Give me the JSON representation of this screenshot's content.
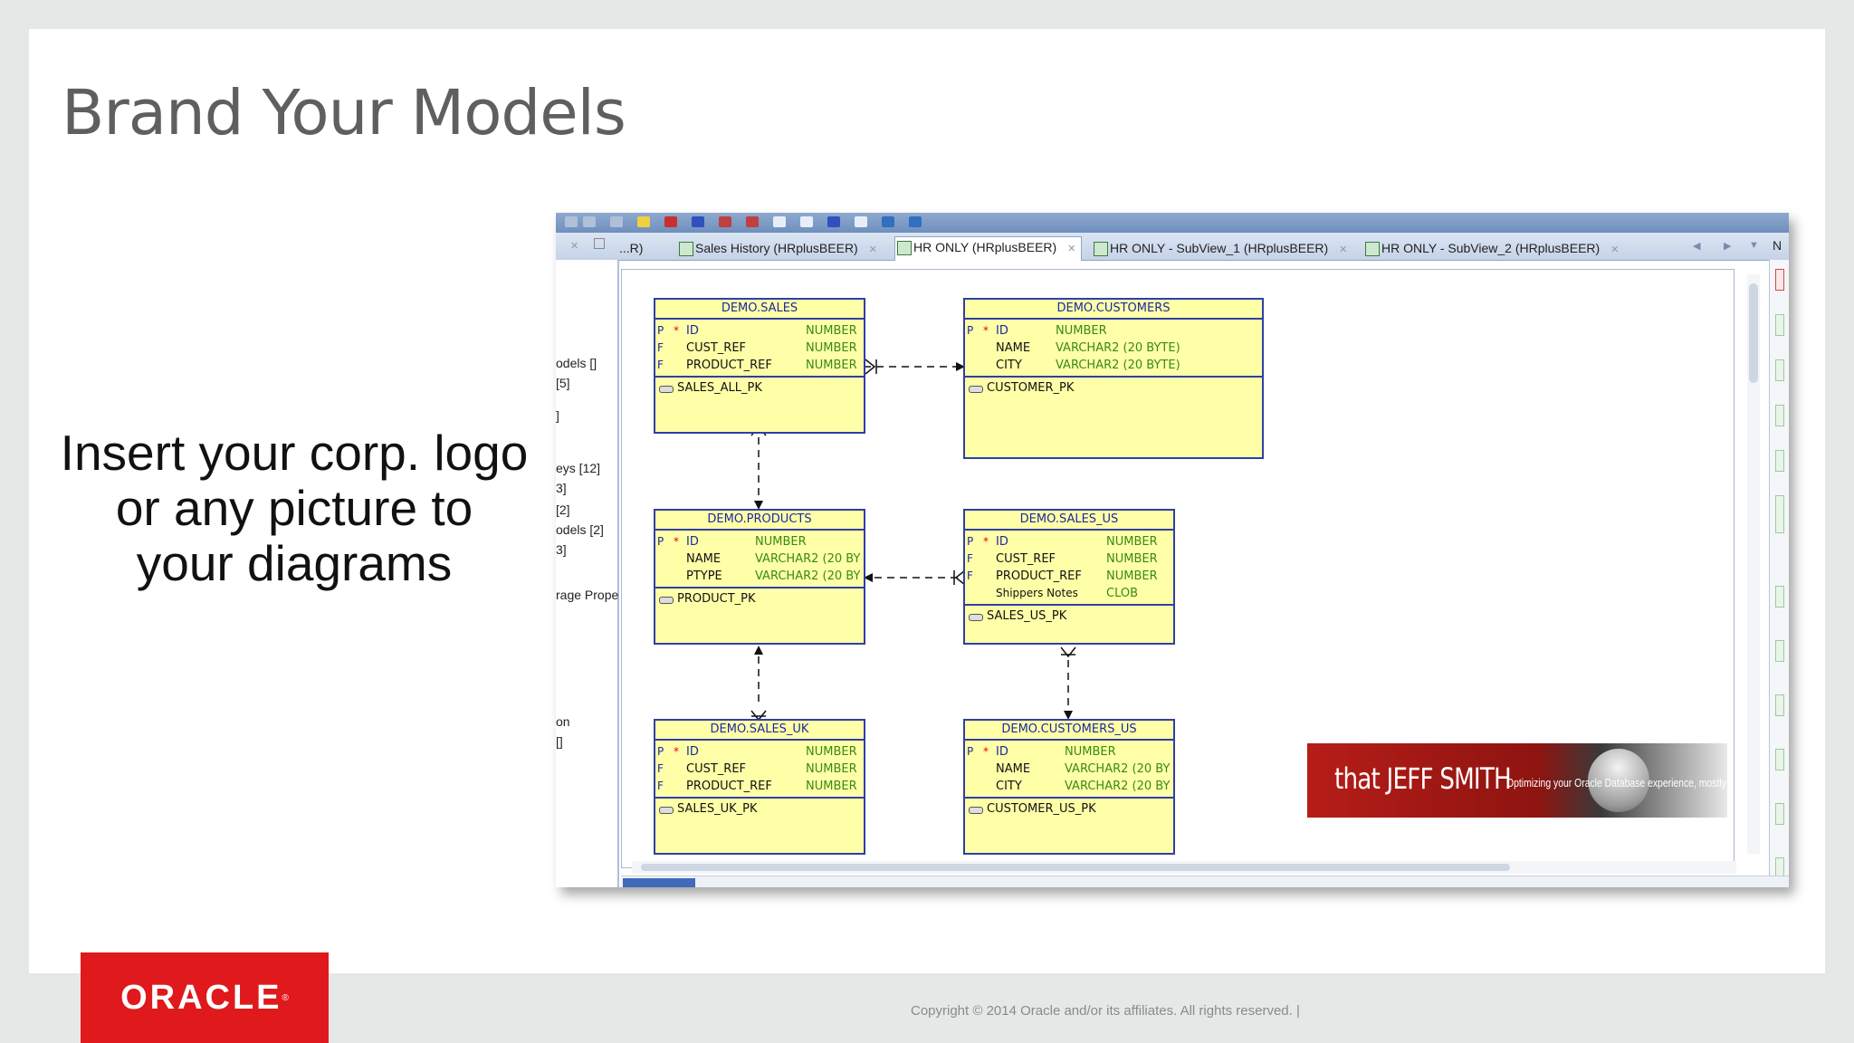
{
  "slide": {
    "title": "Brand Your Models",
    "caption_lines": [
      "Insert your corp. logo",
      "or any picture to",
      "your diagrams"
    ],
    "logo_text": "ORACLE",
    "copyright": "Copyright © 2014 Oracle and/or its affiliates. All rights reserved.  |"
  },
  "tabs": [
    {
      "label": "...R)"
    },
    {
      "label": "Sales History (HRplusBEER)"
    },
    {
      "label": "HR ONLY (HRplusBEER)"
    },
    {
      "label": "HR ONLY - SubView_1 (HRplusBEER)"
    },
    {
      "label": "HR ONLY - SubView_2 (HRplusBEER)"
    }
  ],
  "right_tab_label": "N",
  "left_panel": [
    "odels []",
    "[5]",
    "]",
    "eys [12]",
    "3]",
    "[2]",
    "odels [2]",
    "3]",
    "rage Prope",
    "on",
    "[]"
  ],
  "entities": {
    "sales": {
      "name": "DEMO.SALES",
      "columns": [
        {
          "flag": "P",
          "star": "*",
          "name": "ID",
          "type": "NUMBER"
        },
        {
          "flag": "F",
          "star": "",
          "name": "CUST_REF",
          "type": "NUMBER"
        },
        {
          "flag": "F",
          "star": "",
          "name": "PRODUCT_REF",
          "type": "NUMBER"
        }
      ],
      "key": "SALES_ALL_PK"
    },
    "customers": {
      "name": "DEMO.CUSTOMERS",
      "columns": [
        {
          "flag": "P",
          "star": "*",
          "name": "ID",
          "type": "NUMBER"
        },
        {
          "flag": "",
          "star": "",
          "name": "NAME",
          "type": "VARCHAR2 (20 BYTE)"
        },
        {
          "flag": "",
          "star": "",
          "name": "CITY",
          "type": "VARCHAR2 (20 BYTE)"
        }
      ],
      "key": "CUSTOMER_PK"
    },
    "products": {
      "name": "DEMO.PRODUCTS",
      "columns": [
        {
          "flag": "P",
          "star": "*",
          "name": "ID",
          "type": "NUMBER"
        },
        {
          "flag": "",
          "star": "",
          "name": "NAME",
          "type": "VARCHAR2 (20 BY"
        },
        {
          "flag": "",
          "star": "",
          "name": "PTYPE",
          "type": "VARCHAR2 (20 BY"
        }
      ],
      "key": "PRODUCT_PK"
    },
    "sales_us": {
      "name": "DEMO.SALES_US",
      "columns": [
        {
          "flag": "P",
          "star": "*",
          "name": "ID",
          "type": "NUMBER"
        },
        {
          "flag": "F",
          "star": "",
          "name": "CUST_REF",
          "type": "NUMBER"
        },
        {
          "flag": "F",
          "star": "",
          "name": "PRODUCT_REF",
          "type": "NUMBER"
        },
        {
          "flag": "",
          "star": "",
          "name": "Shippers Notes",
          "type": "CLOB"
        }
      ],
      "key": "SALES_US_PK"
    },
    "sales_uk": {
      "name": "DEMO.SALES_UK",
      "columns": [
        {
          "flag": "P",
          "star": "*",
          "name": "ID",
          "type": "NUMBER"
        },
        {
          "flag": "F",
          "star": "",
          "name": "CUST_REF",
          "type": "NUMBER"
        },
        {
          "flag": "F",
          "star": "",
          "name": "PRODUCT_REF",
          "type": "NUMBER"
        }
      ],
      "key": "SALES_UK_PK"
    },
    "customers_us": {
      "name": "DEMO.CUSTOMERS_US",
      "columns": [
        {
          "flag": "P",
          "star": "*",
          "name": "ID",
          "type": "NUMBER"
        },
        {
          "flag": "",
          "star": "",
          "name": "NAME",
          "type": "VARCHAR2 (20 BY"
        },
        {
          "flag": "",
          "star": "",
          "name": "CITY",
          "type": "VARCHAR2 (20 BY"
        }
      ],
      "key": "CUSTOMER_US_PK"
    }
  },
  "brand_image": {
    "title": "that JEFF SMITH",
    "subtitle": "Optimizing your Oracle Database experience, mostly"
  }
}
